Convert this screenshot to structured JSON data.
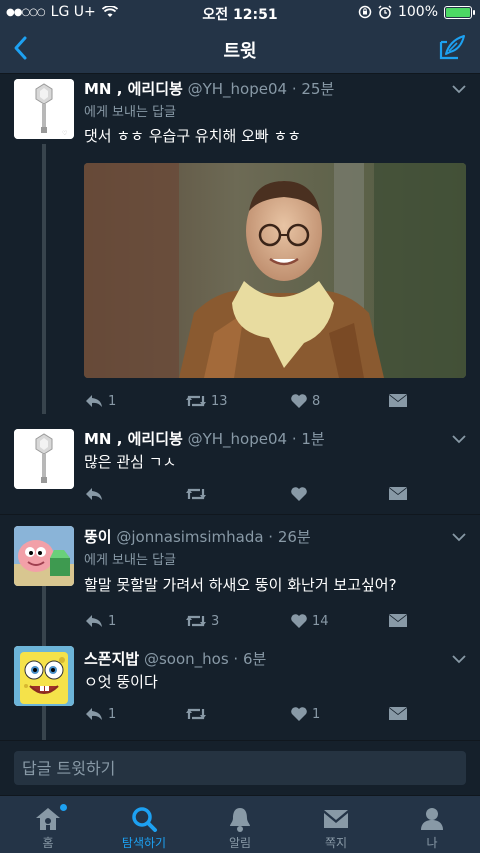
{
  "status_bar": {
    "signal": "●●○○○",
    "carrier": "LG U+",
    "time": "오전 12:51",
    "battery": "100%"
  },
  "nav": {
    "title": "트윗"
  },
  "tweets": [
    {
      "name": "MN , 에리디봉",
      "handle": "@YH_hope04 · 25분",
      "reply_to": "에게 보내는 답글",
      "text": "댓서 ㅎㅎ 우습구 유치해 오빠 ㅎㅎ",
      "replies": "1",
      "retweets": "13",
      "likes": "8"
    },
    {
      "name": "MN , 에리디봉",
      "handle": "@YH_hope04 · 1분",
      "text": "많은 관심 ㄱㅅ"
    },
    {
      "name": "뚱이",
      "handle": "@jonnasimsimhada · 26분",
      "reply_to": "에게 보내는 답글",
      "text": "할말 못할말 가려서 하새오 뚱이 화난거 보고싶어?",
      "replies": "1",
      "retweets": "3",
      "likes": "14"
    },
    {
      "name": "스폰지밥",
      "handle": "@soon_hos · 6분",
      "text": "ㅇ엇 뚱이다",
      "replies": "1",
      "likes": "1"
    }
  ],
  "reply_box": {
    "placeholder": "답글 트윗하기"
  },
  "tabs": [
    {
      "label": "홈"
    },
    {
      "label": "탐색하기"
    },
    {
      "label": "알림"
    },
    {
      "label": "쪽지"
    },
    {
      "label": "나"
    }
  ],
  "colors": {
    "background": "#15202b",
    "bar": "#243447",
    "accent": "#1da1f2",
    "muted": "#8899a6"
  }
}
